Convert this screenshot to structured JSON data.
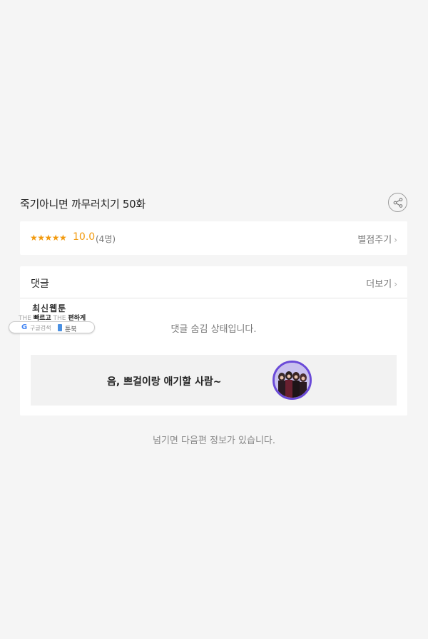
{
  "title": "죽기아니면 까무러치기 50화",
  "rating": {
    "stars": "★★★★★",
    "score": "10.0",
    "count": "(4명)",
    "rate_label": "별점주기"
  },
  "comments": {
    "title": "댓글",
    "more_label": "더보기",
    "hidden_message": "댓글 숨김 상태입니다."
  },
  "banner": {
    "text": "음, 쁘걸이랑 애기할 사람~"
  },
  "footer_note": "넘기면 다음편 정보가 있습니다.",
  "widget": {
    "title": "최신웹툰",
    "sub_the1": "THE",
    "sub_fast": "빠르고",
    "sub_the2": "THE",
    "sub_easy": "편하게",
    "google_label": "구글검색",
    "toonbook_label": "툰북"
  },
  "colors": {
    "accent": "#f29a0e",
    "background": "#f5f5f5",
    "avatar_border": "#6a4ad8"
  },
  "icons": {
    "share": "share-icon",
    "chevron": "chevron-right-icon",
    "google": "google-icon"
  }
}
